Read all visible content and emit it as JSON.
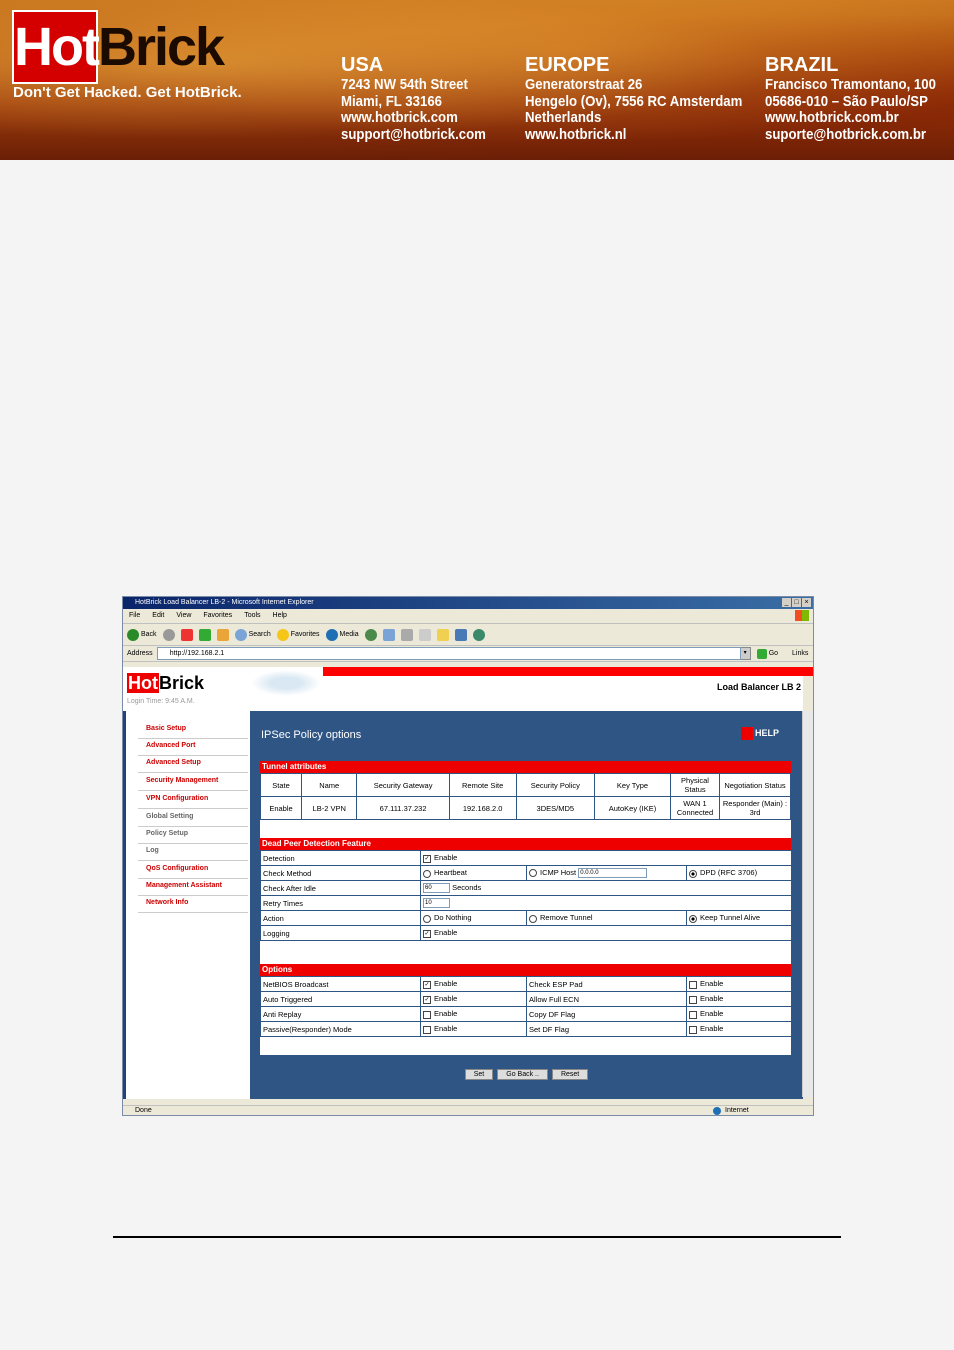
{
  "banner": {
    "logo_hot": "Hot",
    "logo_brick": "Brick",
    "slogan": "Don't Get Hacked. Get HotBrick.",
    "offices": [
      {
        "heading": "USA",
        "lines": [
          "7243 NW 54th Street",
          "Miami, FL 33166",
          "www.hotbrick.com",
          "support@hotbrick.com"
        ]
      },
      {
        "heading": "EUROPE",
        "lines": [
          "Generatorstraat 26",
          "Hengelo (Ov), 7556 RC Amsterdam",
          "Netherlands",
          "www.hotbrick.nl"
        ]
      },
      {
        "heading": "BRAZIL",
        "lines": [
          "Francisco Tramontano, 100",
          "05686-010 – São Paulo/SP",
          "www.hotbrick.com.br",
          "suporte@hotbrick.com.br"
        ]
      }
    ]
  },
  "browser": {
    "title": "HotBrick Load Balancer LB-2 - Microsoft Internet Explorer",
    "menu": [
      "File",
      "Edit",
      "View",
      "Favorites",
      "Tools",
      "Help"
    ],
    "toolbar": {
      "back": "Back",
      "search": "Search",
      "favorites": "Favorites",
      "media": "Media"
    },
    "address_label": "Address",
    "address_value": "http://192.168.2.1",
    "go": "Go",
    "links": "Links",
    "status": "Done",
    "zone": "Internet"
  },
  "app": {
    "logo_hot": "Hot",
    "logo_brick": "Brick",
    "device_title": "Load Balancer LB 2",
    "login_time": "Login Time: 9:45 A.M.",
    "sidebar": [
      {
        "label": "Basic Setup"
      },
      {
        "label": "Advanced Port"
      },
      {
        "label": "Advanced Setup"
      },
      {
        "label": "Security Management"
      },
      {
        "label": "VPN Configuration"
      },
      {
        "label": "Global Setting"
      },
      {
        "label": "Policy Setup"
      },
      {
        "label": "Log"
      },
      {
        "label": "QoS Configuration"
      },
      {
        "label": "Management Assistant"
      },
      {
        "label": "Network Info"
      }
    ],
    "page_title": "IPSec Policy options",
    "help": "HELP",
    "tunnel": {
      "section": "Tunnel attributes",
      "headers": [
        "State",
        "Name",
        "Security Gateway",
        "Remote Site",
        "Security Policy",
        "Key Type",
        "Physical Status",
        "Negotiation Status"
      ],
      "row": [
        "Enable",
        "LB-2 VPN",
        "67.111.37.232",
        "192.168.2.0",
        "3DES/MD5",
        "AutoKey (IKE)",
        "WAN 1 Connected",
        "Responder (Main) : 3rd"
      ]
    },
    "dpd": {
      "section": "Dead Peer Detection Feature",
      "detection_label": "Detection",
      "enable": "Enable",
      "check_method_label": "Check Method",
      "heartbeat": "Heartbeat",
      "icmp_host": "ICMP Host",
      "icmp_value": "0.0.0.0",
      "dpd_rfc": "DPD (RFC 3706)",
      "check_after_idle_label": "Check After Idle",
      "idle_value": "60",
      "seconds": "Seconds",
      "retry_label": "Retry Times",
      "retry_value": "10",
      "action_label": "Action",
      "do_nothing": "Do Nothing",
      "remove_tunnel": "Remove Tunnel",
      "keep_alive": "Keep Tunnel Alive",
      "logging_label": "Logging"
    },
    "options": {
      "section": "Options",
      "left": [
        {
          "label": "NetBIOS Broadcast",
          "checked": true
        },
        {
          "label": "Auto Triggered",
          "checked": true
        },
        {
          "label": "Anti Replay",
          "checked": false
        },
        {
          "label": "Passive(Responder) Mode",
          "checked": false
        }
      ],
      "right": [
        {
          "label": "Check ESP Pad",
          "checked": false
        },
        {
          "label": "Allow Full ECN",
          "checked": false
        },
        {
          "label": "Copy DF Flag",
          "checked": false
        },
        {
          "label": "Set DF Flag",
          "checked": false
        }
      ],
      "enable": "Enable"
    },
    "buttons": {
      "set": "Set",
      "go_back": "Go Back ..",
      "reset": "Reset"
    }
  }
}
